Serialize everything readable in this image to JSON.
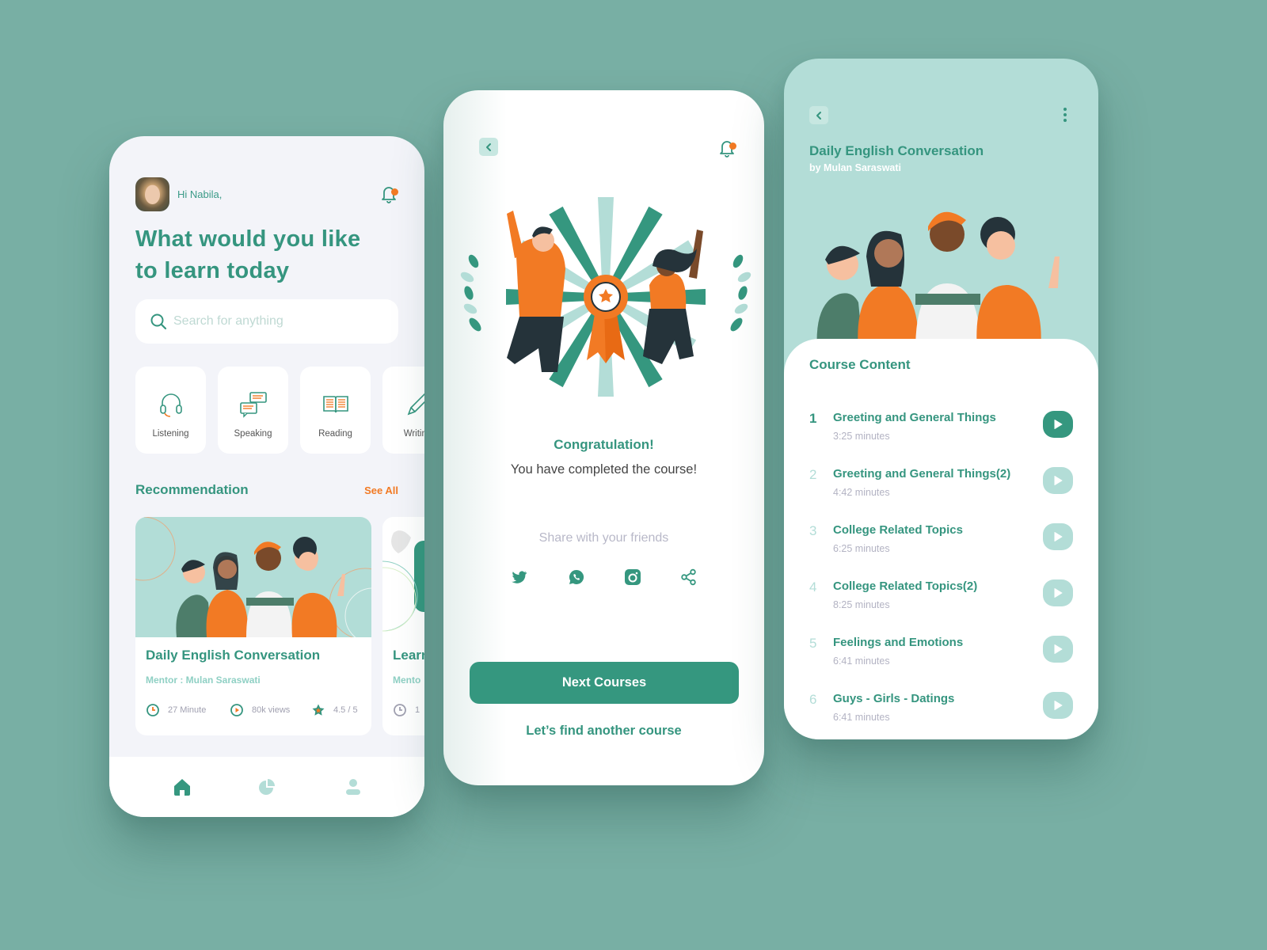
{
  "colors": {
    "background": "#78afa4",
    "primary": "#35977f",
    "primary_light": "#b3ddd7",
    "accent": "#f27a24",
    "muted_text": "#b3b3c3",
    "light_bg": "#f3f4f9"
  },
  "home_screen": {
    "greeting": "Hi Nabila,",
    "headline": "What would you like to learn today",
    "search": {
      "placeholder": "Search for anything",
      "value": ""
    },
    "categories": [
      {
        "label": "Listening",
        "icon": "headphones-icon"
      },
      {
        "label": "Speaking",
        "icon": "chat-bubbles-icon"
      },
      {
        "label": "Reading",
        "icon": "open-book-icon"
      },
      {
        "label": "Writing",
        "icon": "pencil-icon"
      }
    ],
    "recommendation": {
      "title": "Recommendation",
      "see_all": "See All",
      "courses": [
        {
          "title": "Daily English Conversation",
          "mentor": "Mentor : Mulan Saraswati",
          "duration": "27 Minute",
          "views": "80k views",
          "rating": "4.5 / 5"
        },
        {
          "title": "Learn",
          "mentor": "Mento",
          "duration": "1"
        }
      ]
    },
    "tabbar": [
      {
        "name": "home",
        "icon": "home-icon",
        "active": true
      },
      {
        "name": "stats",
        "icon": "pie-chart-icon",
        "active": false
      },
      {
        "name": "profile",
        "icon": "user-icon",
        "active": false
      }
    ]
  },
  "congrats_screen": {
    "title": "Congratulation!",
    "subtitle": "You have completed the course!",
    "share_label": "Share with your friends",
    "share_targets": [
      {
        "name": "twitter",
        "icon": "twitter-icon"
      },
      {
        "name": "whatsapp",
        "icon": "whatsapp-icon"
      },
      {
        "name": "instagram",
        "icon": "instagram-icon"
      },
      {
        "name": "share",
        "icon": "share-icon"
      }
    ],
    "primary_button": "Next Courses",
    "secondary_link": "Let’s find another course"
  },
  "course_screen": {
    "title": "Daily English Conversation",
    "author": "by Mulan Saraswati",
    "content_title": "Course Content",
    "lessons": [
      {
        "number": "1",
        "title": "Greeting and General Things",
        "duration": "3:25 minutes",
        "active": true
      },
      {
        "number": "2",
        "title": "Greeting and General Things(2)",
        "duration": "4:42 minutes",
        "active": false
      },
      {
        "number": "3",
        "title": "College Related Topics",
        "duration": "6:25 minutes",
        "active": false
      },
      {
        "number": "4",
        "title": "College Related Topics(2)",
        "duration": "8:25 minutes",
        "active": false
      },
      {
        "number": "5",
        "title": "Feelings and Emotions",
        "duration": "6:41 minutes",
        "active": false
      },
      {
        "number": "6",
        "title": "Guys - Girls - Datings",
        "duration": "6:41 minutes",
        "active": false
      }
    ]
  }
}
